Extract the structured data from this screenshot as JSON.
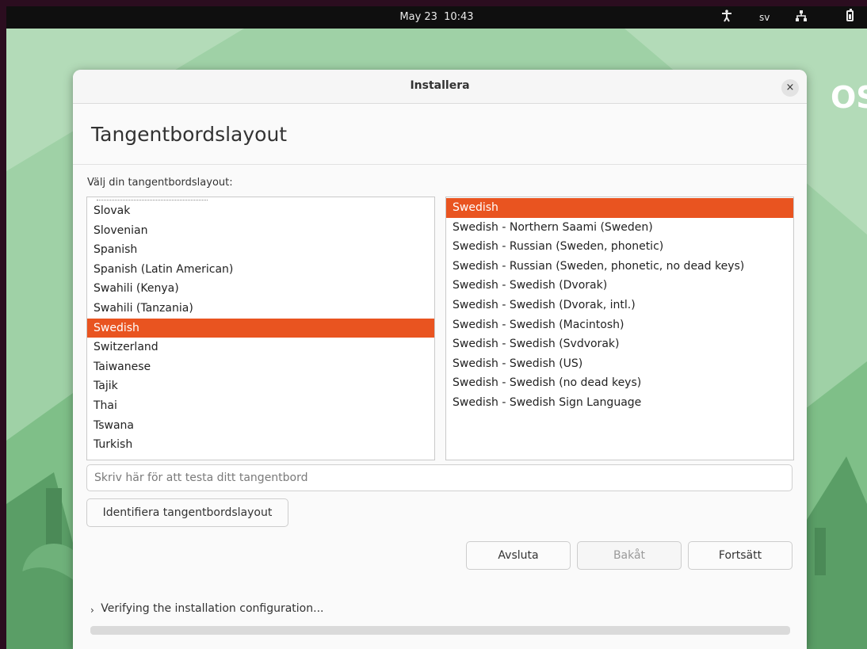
{
  "topbar": {
    "date": "May 23",
    "time": "10:43",
    "language_indicator": "sv",
    "icons": [
      "accessibility-icon",
      "network-icon",
      "battery-icon"
    ]
  },
  "desktop": {
    "logo_fragment": "OS"
  },
  "window": {
    "title": "Installera",
    "close_symbol": "×"
  },
  "page": {
    "heading": "Tangentbordslayout",
    "prompt": "Välj din tangentbordslayout:"
  },
  "layouts": [
    "Slovak",
    "Slovenian",
    "Spanish",
    "Spanish (Latin American)",
    "Swahili (Kenya)",
    "Swahili (Tanzania)",
    "Swedish",
    "Switzerland",
    "Taiwanese",
    "Tajik",
    "Thai",
    "Tswana",
    "Turkish"
  ],
  "selected_layout": "Swedish",
  "variants": [
    "Swedish",
    "Swedish - Northern Saami (Sweden)",
    "Swedish - Russian (Sweden, phonetic)",
    "Swedish - Russian (Sweden, phonetic, no dead keys)",
    "Swedish - Swedish (Dvorak)",
    "Swedish - Swedish (Dvorak, intl.)",
    "Swedish - Swedish (Macintosh)",
    "Swedish - Swedish (Svdvorak)",
    "Swedish - Swedish (US)",
    "Swedish - Swedish (no dead keys)",
    "Swedish - Swedish Sign Language"
  ],
  "selected_variant": "Swedish",
  "test_field": {
    "value": "",
    "placeholder": "Skriv här för att testa ditt tangentbord"
  },
  "buttons": {
    "identify": "Identifiera tangentbordslayout",
    "quit": "Avsluta",
    "back": "Bakåt",
    "continue": "Fortsätt"
  },
  "status": {
    "text": "Verifying the installation configuration...",
    "progress": 0
  },
  "colors": {
    "accent": "#e95420",
    "topbar": "#0f0f0f",
    "wallpaper": "#9fd1a6"
  }
}
